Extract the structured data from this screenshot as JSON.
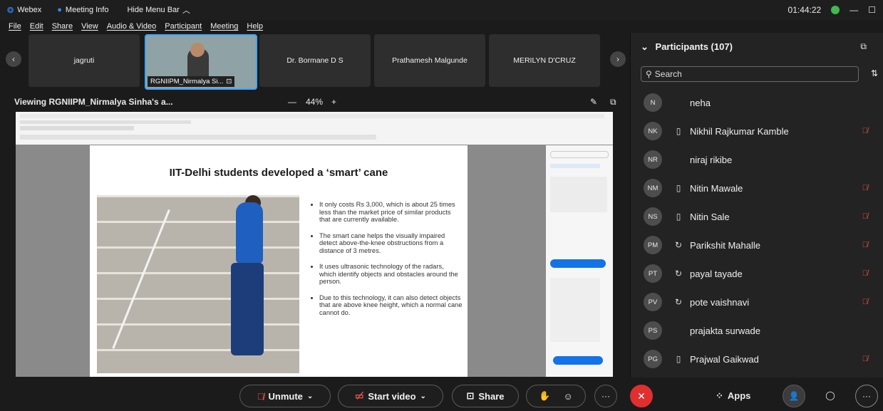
{
  "titlebar": {
    "app_name": "Webex",
    "meeting_info": "Meeting Info",
    "hide_menu_bar": "Hide Menu Bar",
    "timer": "01:44:22"
  },
  "menu": [
    "File",
    "Edit",
    "Share",
    "View",
    "Audio & Video",
    "Participant",
    "Meeting",
    "Help"
  ],
  "video_strip": {
    "tiles": [
      "jagruti",
      "RGNIIPM_Nirmalya Si...",
      "Dr. Bormane D S",
      "Prathamesh Malgunde",
      "MERILYN D'CRUZ"
    ]
  },
  "viewing": {
    "label": "Viewing RGNIIPM_Nirmalya Sinha's a...",
    "zoom": "44%",
    "zoom_out": "—",
    "zoom_in": "+"
  },
  "slide": {
    "title": "IIT-Delhi students developed a ‘smart’ cane",
    "bullets": [
      "It only costs Rs 3,000, which is about 25 times less than the market price of similar products that are currently available.",
      "The smart cane helps the visually impaired detect above-the-knee obstructions from a distance of 3 metres.",
      "It uses ultrasonic technology of the radars, which identify objects and obstacles around the person.",
      "Due to this technology, it can also detect objects that are above knee height, which a normal cane cannot do."
    ]
  },
  "controls": {
    "unmute": "Unmute",
    "start_video": "Start video",
    "share": "Share",
    "more": "···",
    "apps": "Apps"
  },
  "participants": {
    "header": "Participants (107)",
    "search_placeholder": "Search",
    "list": [
      {
        "initials": "N",
        "name": "neha",
        "type": "",
        "muted": false
      },
      {
        "initials": "NK",
        "name": "Nikhil Rajkumar Kamble",
        "type": "device",
        "muted": true
      },
      {
        "initials": "NR",
        "name": "niraj rikibe",
        "type": "",
        "muted": false
      },
      {
        "initials": "NM",
        "name": "Nitin Mawale",
        "type": "device",
        "muted": true
      },
      {
        "initials": "NS",
        "name": "Nitin Sale",
        "type": "device",
        "muted": true
      },
      {
        "initials": "PM",
        "name": "Parikshit Mahalle",
        "type": "sync",
        "muted": true
      },
      {
        "initials": "PT",
        "name": "payal tayade",
        "type": "sync",
        "muted": true
      },
      {
        "initials": "PV",
        "name": "pote vaishnavi",
        "type": "sync",
        "muted": true
      },
      {
        "initials": "PS",
        "name": "prajakta surwade",
        "type": "",
        "muted": false
      },
      {
        "initials": "PG",
        "name": "Prajwal Gaikwad",
        "type": "device",
        "muted": true
      }
    ]
  },
  "colors": {
    "accent": "#3ea6ff",
    "muted_red": "#e5534b",
    "end_red": "#e02f2f"
  }
}
